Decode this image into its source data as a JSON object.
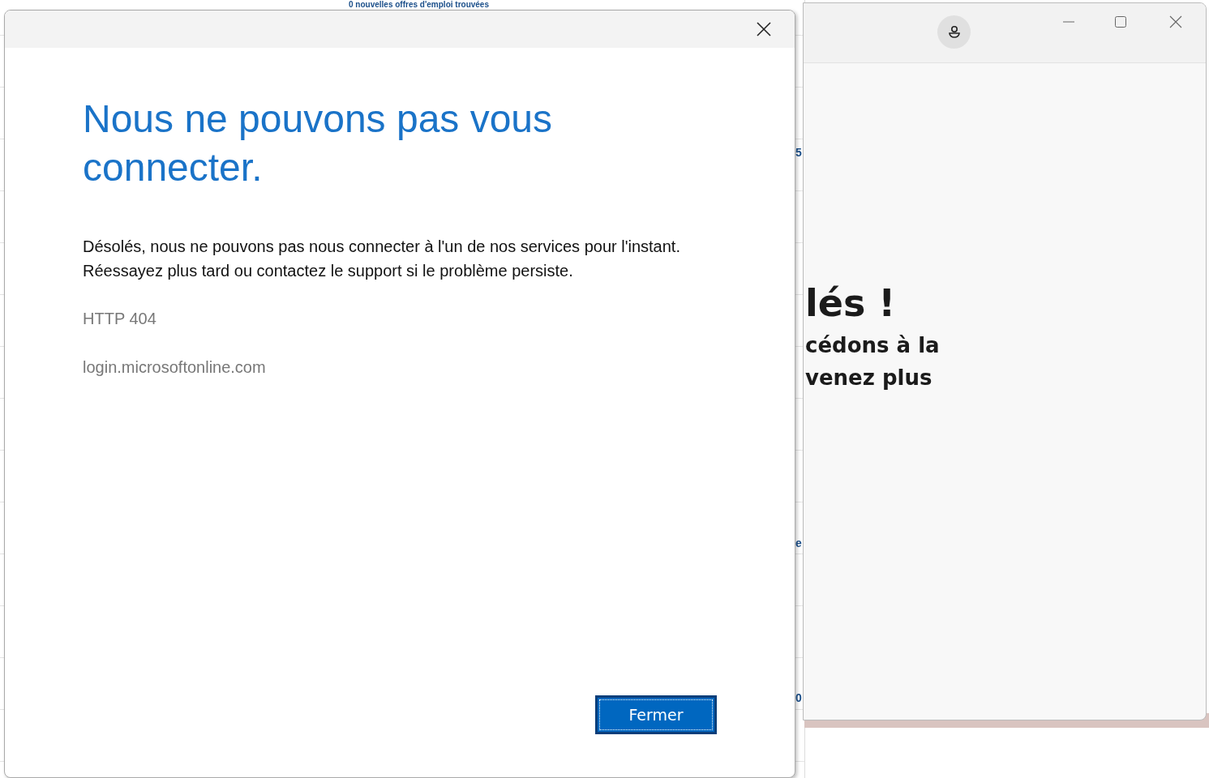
{
  "background_page": {
    "heading": "0 nouvelles offres d'emploi trouvées",
    "edge_fragments": [
      "5",
      "e",
      "0"
    ]
  },
  "app_window": {
    "heading": "lés !",
    "lines": [
      "cédons à la",
      "venez plus"
    ]
  },
  "dialog": {
    "title": "Nous ne pouvons pas vous connecter.",
    "message": "Désolés, nous ne pouvons pas nous connecter à l'un de nos services pour l'instant. Réessayez plus tard ou contactez le support si le problème persiste.",
    "error_code": "HTTP 404",
    "host": "login.microsoftonline.com",
    "button": {
      "label": "Fermer",
      "focused": true
    }
  }
}
